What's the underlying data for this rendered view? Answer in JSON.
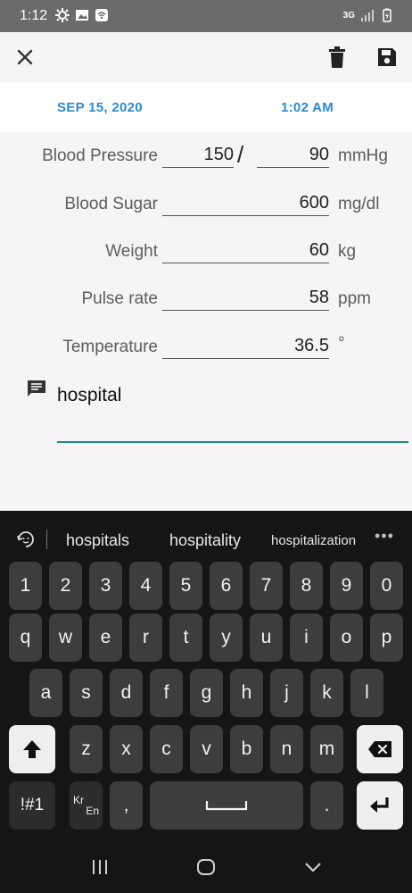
{
  "status_bar": {
    "time": "1:12",
    "network_label": "3G"
  },
  "app_bar": {
    "close_icon": "close-icon",
    "delete_icon": "trash-icon",
    "save_icon": "save-icon"
  },
  "datetime": {
    "date": "SEP 15, 2020",
    "time": "1:02 AM"
  },
  "form": {
    "blood_pressure": {
      "label": "Blood Pressure",
      "systolic": "150",
      "separator": "/",
      "diastolic": "90",
      "unit": "mmHg"
    },
    "blood_sugar": {
      "label": "Blood Sugar",
      "value": "600",
      "unit": "mg/dl"
    },
    "weight": {
      "label": "Weight",
      "value": "60",
      "unit": "kg"
    },
    "pulse": {
      "label": "Pulse rate",
      "value": "58",
      "unit": "ppm"
    },
    "temperature": {
      "label": "Temperature",
      "value": "36.5",
      "unit": "°"
    }
  },
  "note": {
    "icon": "comment-icon",
    "text": "hospital"
  },
  "keyboard": {
    "suggestions": [
      "hospitals",
      "hospitality",
      "hospitalization"
    ],
    "more": "•••",
    "rows": [
      [
        "1",
        "2",
        "3",
        "4",
        "5",
        "6",
        "7",
        "8",
        "9",
        "0"
      ],
      [
        "q",
        "w",
        "e",
        "r",
        "t",
        "y",
        "u",
        "i",
        "o",
        "p"
      ],
      [
        "a",
        "s",
        "d",
        "f",
        "g",
        "h",
        "j",
        "k",
        "l"
      ],
      [
        "z",
        "x",
        "c",
        "v",
        "b",
        "n",
        "m"
      ]
    ],
    "symbols_key": "!#1",
    "lang_key_top": "Kr",
    "lang_key_bottom": "En",
    "comma_key": ",",
    "period_key": ".",
    "accent_color": "#1f8a7a"
  },
  "nav": {
    "recents_icon": "recents-icon",
    "home_icon": "home-icon",
    "back_icon": "back-chevron-icon"
  }
}
